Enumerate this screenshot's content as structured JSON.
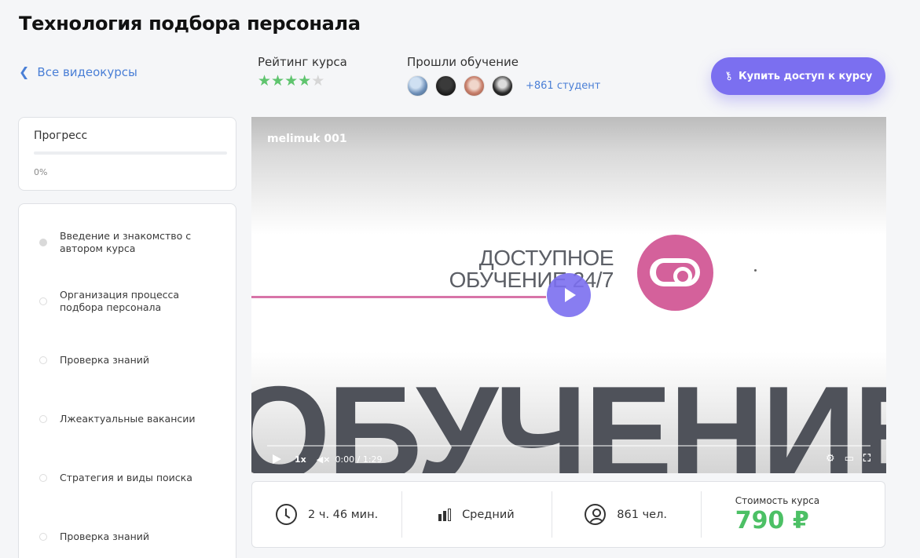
{
  "page": {
    "title": "Технология подбора персонала"
  },
  "nav": {
    "back_label": "Все видеокурсы"
  },
  "rating": {
    "label": "Рейтинг курса",
    "stars_filled": 4,
    "stars_total": 5,
    "color_on": "#5fc46e"
  },
  "students": {
    "label": "Прошли обучение",
    "more_label": "+861 студент"
  },
  "buy": {
    "label": "Купить доступ к курсу",
    "color": "#7b6ff0"
  },
  "progress": {
    "title": "Прогресс",
    "percent_label": "0%",
    "value": 0
  },
  "lessons": [
    {
      "title": "Введение и знакомство с автором курса",
      "active": true
    },
    {
      "title": "Организация процесса подбора персонала",
      "active": false
    },
    {
      "title": "Проверка знаний",
      "active": false
    },
    {
      "title": "Лжеактуальные вакансии",
      "active": false
    },
    {
      "title": "Стратегия и виды поиска",
      "active": false
    },
    {
      "title": "Проверка знаний",
      "active": false
    }
  ],
  "video": {
    "title": "melimuk 001",
    "promo_line1": "ДОСТУПНОЕ",
    "promo_line2": "ОБУЧЕНИЕ 24/7",
    "big_word": "ОБУЧЕНИЕ",
    "speed": "1x",
    "mute_icon": "◀×",
    "time": "0:00 / 1:29"
  },
  "stats": {
    "duration": "2 ч. 46 мин.",
    "level": "Средний",
    "people": "861 чел.",
    "price_label": "Стоимость курса",
    "price": "790 ₽",
    "price_color": "#4cc065"
  }
}
